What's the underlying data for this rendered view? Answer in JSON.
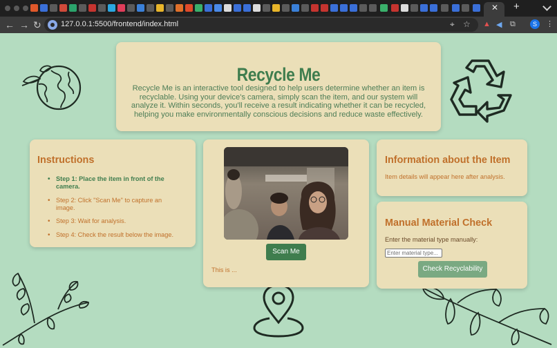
{
  "browser": {
    "url": "127.0.0.1:5500/frontend/index.html",
    "profile_initial": "S"
  },
  "header": {
    "title": "Recycle Me",
    "description": "Recycle Me is an interactive tool designed to help users determine whether an item is recyclable. Using your device's camera, simply scan the item, and our system will analyze it. Within seconds, you'll receive a result indicating whether it can be recycled, helping you make environmentally conscious decisions and reduce waste effectively."
  },
  "instructions": {
    "title": "Instructions",
    "steps": [
      "Step 1: Place the item in front of the camera.",
      "Step 2: Click \"Scan Me\" to capture an image.",
      "Step 3: Wait for analysis.",
      "Step 4: Check the result below the image."
    ]
  },
  "scanner": {
    "button_label": "Scan Me",
    "result_text": "This is ..."
  },
  "item_info": {
    "title": "Information about the Item",
    "placeholder_text": "Item details will appear here after analysis."
  },
  "manual_check": {
    "title": "Manual Material Check",
    "label": "Enter the material type manually:",
    "input_placeholder": "Enter material type...",
    "input_value": "",
    "button_label": "Check Recyclability"
  },
  "colors": {
    "page_bg": "#b4dcc0",
    "card_bg": "#ebdfb8",
    "accent_green": "#3f7d4e",
    "accent_orange": "#c0702b",
    "button_light_green": "#7aa982"
  },
  "icons": [
    "globe-icon",
    "recycle-icon",
    "leaf-branch-icon",
    "location-pin-icon"
  ]
}
